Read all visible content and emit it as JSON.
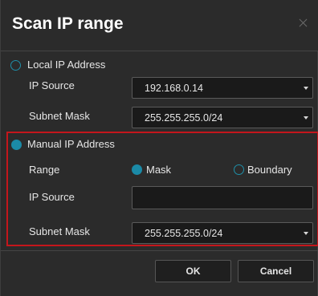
{
  "dialog": {
    "title": "Scan IP range"
  },
  "local": {
    "label": "Local IP Address",
    "selected": false,
    "ip_source_label": "IP Source",
    "ip_source_value": "192.168.0.14",
    "subnet_label": "Subnet Mask",
    "subnet_value": "255.255.255.0/24"
  },
  "manual": {
    "label": "Manual IP Address",
    "selected": true,
    "range_label": "Range",
    "range_options": [
      {
        "label": "Mask",
        "selected": true
      },
      {
        "label": "Boundary",
        "selected": false
      }
    ],
    "ip_source_label": "IP Source",
    "ip_source_value": "",
    "subnet_label": "Subnet Mask",
    "subnet_value": "255.255.255.0/24"
  },
  "buttons": {
    "ok": "OK",
    "cancel": "Cancel"
  },
  "colors": {
    "accent": "#1b8aa7",
    "highlight_border": "#c4161c",
    "background": "#2b2b2b"
  },
  "icons": {
    "close": "close-icon",
    "dropdown": "chevron-down-icon"
  }
}
